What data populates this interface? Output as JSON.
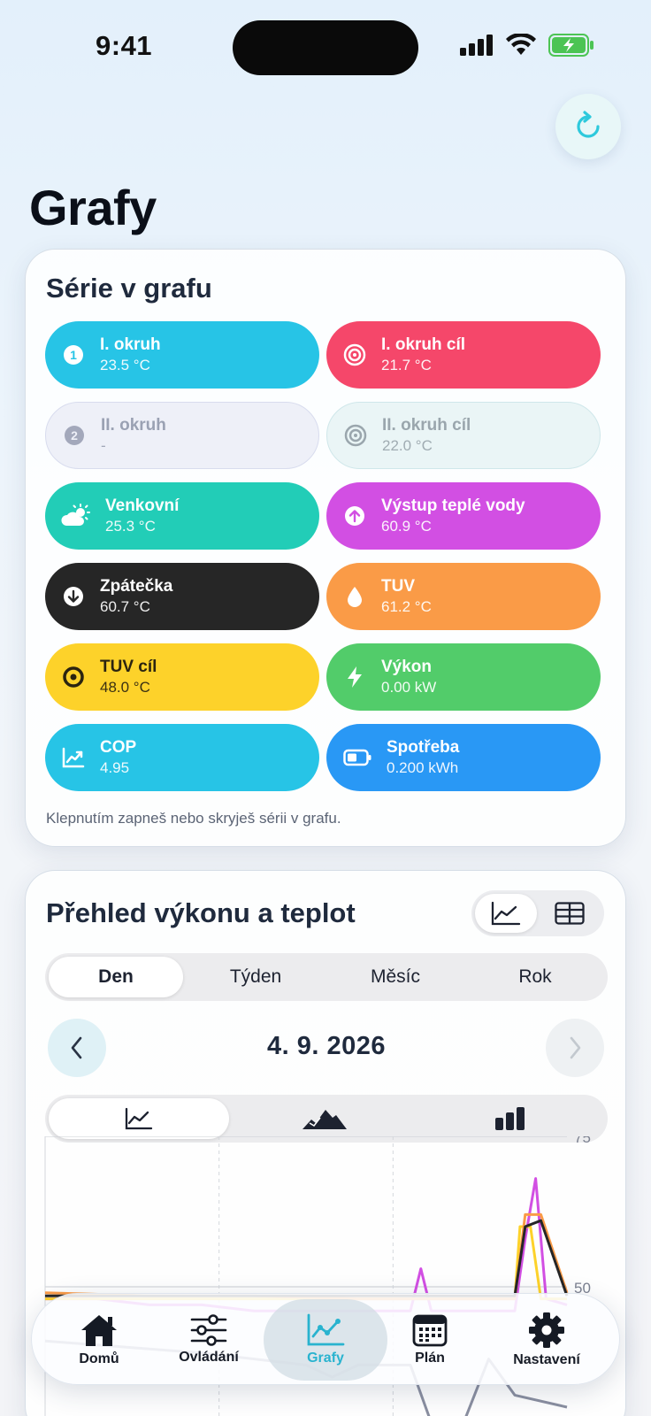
{
  "status": {
    "time": "9:41"
  },
  "page": {
    "title": "Grafy"
  },
  "series_card": {
    "title": "Série v grafu",
    "hint": "Klepnutím zapneš nebo skryješ sérii v grafu.",
    "items": [
      {
        "name": "I. okruh",
        "value": "23.5 °C",
        "icon": "circle-one-icon",
        "color": "#27c4e6",
        "active": true
      },
      {
        "name": "I. okruh cíl",
        "value": "21.7 °C",
        "icon": "target-icon",
        "color": "#f5476a",
        "active": true
      },
      {
        "name": "II. okruh",
        "value": "-",
        "icon": "circle-two-icon",
        "color": "#eef0f8",
        "active": false
      },
      {
        "name": "II. okruh cíl",
        "value": "22.0 °C",
        "icon": "target-icon",
        "color": "#eaf5f6",
        "active": false
      },
      {
        "name": "Venkovní",
        "value": "25.3 °C",
        "icon": "cloud-sun-icon",
        "color": "#22cdb7",
        "active": true
      },
      {
        "name": "Výstup teplé vody",
        "value": "60.9 °C",
        "icon": "arrow-up-circle-icon",
        "color": "#d24fe3",
        "active": true
      },
      {
        "name": "Zpátečka",
        "value": "60.7 °C",
        "icon": "arrow-down-circle-icon",
        "color": "#262626",
        "active": true
      },
      {
        "name": "TUV",
        "value": "61.2 °C",
        "icon": "drop-icon",
        "color": "#fa9b47",
        "active": true
      },
      {
        "name": "TUV cíl",
        "value": "48.0 °C",
        "icon": "target-dot-icon",
        "color": "#fdd22a",
        "active": true,
        "dark_text": true
      },
      {
        "name": "Výkon",
        "value": "0.00 kW",
        "icon": "bolt-icon",
        "color": "#52cc6a",
        "active": true
      },
      {
        "name": "COP",
        "value": "4.95",
        "icon": "chart-up-icon",
        "color": "#27c4e6",
        "active": true
      },
      {
        "name": "Spotřeba",
        "value": "0.200 kWh",
        "icon": "battery-icon",
        "color": "#2998f5",
        "active": true
      }
    ]
  },
  "chart_card": {
    "title": "Přehled výkonu a teplot",
    "periods": [
      "Den",
      "Týden",
      "Měsíc",
      "Rok"
    ],
    "active_period": "Den",
    "date": "4. 9. 2026",
    "view_modes": [
      "line-chart-icon",
      "table-icon"
    ],
    "chart_types": [
      "line-chart-icon",
      "area-chart-icon",
      "bar-chart-icon"
    ]
  },
  "chart_data": {
    "type": "line",
    "yticks": [
      "75",
      "50"
    ],
    "ylim": [
      25,
      75
    ],
    "grid": true,
    "series": [
      {
        "color": "#d24fe3",
        "x": [
          0,
          0.1,
          0.2,
          0.3,
          0.4,
          0.5,
          0.6,
          0.7,
          0.72,
          0.74,
          0.8,
          0.9,
          0.92,
          0.94,
          0.96,
          1.0
        ],
        "y": [
          48,
          48,
          47,
          47,
          46,
          46,
          46,
          46,
          53,
          46,
          46,
          46,
          58,
          68,
          48,
          47
        ]
      },
      {
        "color": "#fdd22a",
        "x": [
          0,
          0.1,
          0.5,
          0.9,
          0.91,
          0.93,
          0.95,
          1.0
        ],
        "y": [
          48,
          48,
          48,
          48,
          60,
          60,
          48,
          48
        ]
      },
      {
        "color": "#fa9b47",
        "x": [
          0,
          0.2,
          0.4,
          0.6,
          0.8,
          0.9,
          0.92,
          0.95,
          1.0
        ],
        "y": [
          49,
          48.5,
          48.5,
          48,
          48,
          48,
          62,
          62,
          49
        ]
      },
      {
        "color": "#262626",
        "x": [
          0,
          0.9,
          0.92,
          0.95,
          1.0
        ],
        "y": [
          48.5,
          48.5,
          60,
          61,
          48.5
        ]
      },
      {
        "color": "#8a8fa0",
        "x": [
          0,
          0.3,
          0.5,
          0.55,
          0.6,
          0.7,
          0.75,
          0.8,
          0.85,
          0.9,
          1.0
        ],
        "y": [
          41,
          39,
          37,
          35,
          37,
          37,
          25,
          27,
          38,
          32,
          30
        ]
      }
    ]
  },
  "tab_bar": {
    "tabs": [
      {
        "label": "Domů",
        "icon": "home-icon"
      },
      {
        "label": "Ovládání",
        "icon": "sliders-icon"
      },
      {
        "label": "Grafy",
        "icon": "chart-icon"
      },
      {
        "label": "Plán",
        "icon": "calendar-icon"
      },
      {
        "label": "Nastavení",
        "icon": "gear-icon"
      }
    ],
    "active": "Grafy"
  }
}
